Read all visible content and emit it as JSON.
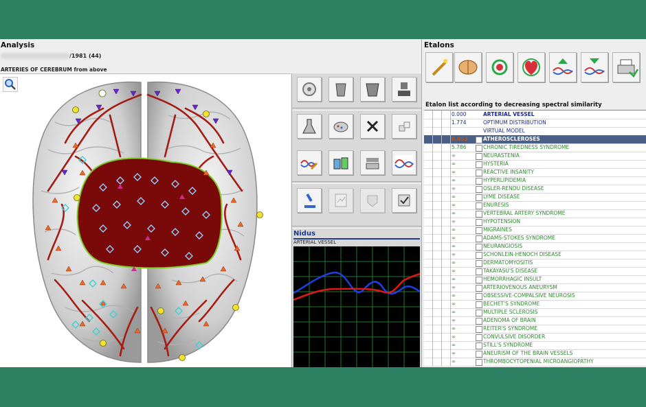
{
  "analysis": {
    "title": "Analysis",
    "patient_suffix": "/1981 (44)",
    "area_label": "ARTERIES  OF  CEREBRUM  from above"
  },
  "viewer": {
    "zoom_icon": "magnifier-icon"
  },
  "tools": {
    "icons": [
      "target-icon",
      "cup-icon",
      "cup-wide-icon",
      "stamp-icon",
      "flask-icon",
      "pipette-icon",
      "close-x-icon",
      "cubes-icon",
      "wave-pencil-icon",
      "beakers-icon",
      "tray-icon",
      "signal-icon",
      "microscope-icon",
      "report-icon",
      "tag-icon",
      "stamp-check-icon"
    ]
  },
  "nidus": {
    "title": "Nidus",
    "subtitle": "ARTERIAL VESSEL",
    "colors": {
      "series_a": "#1f3fe0",
      "series_b": "#e01818",
      "grid": "#1f7a2a"
    }
  },
  "etalons": {
    "title": "Etalons",
    "toolbar_icons": [
      "magic-wand-icon",
      "brain-icon",
      "organ-cycle-icon",
      "heart-icon",
      "spectrum-up-icon",
      "spectrum-down-icon",
      "printer-icon"
    ],
    "list_caption": "Etalon list according to decreasing spectral similarity",
    "rows": [
      {
        "value": "0.000",
        "name": "ARTERIAL VESSEL",
        "style": "header"
      },
      {
        "value": "1.774",
        "name": "OPTIMUM DISTRIBUTION",
        "style": "header"
      },
      {
        "value": "",
        "name": "VIRTUAL MODEL",
        "style": "header"
      },
      {
        "value": "0.053",
        "name": "ATHEROSCLEROSES",
        "style": "selected"
      },
      {
        "value": "5.786",
        "name": "CHRONIC TIREDNESS SYNDROME",
        "style": "item"
      },
      {
        "value": "∞",
        "name": "NEURASTENIA",
        "style": "item"
      },
      {
        "value": "∞",
        "name": "HYSTERIA",
        "style": "item"
      },
      {
        "value": "∞",
        "name": "REACTIVE  INSANITY",
        "style": "item"
      },
      {
        "value": "∞",
        "name": "HYPERLIPIDEMIA",
        "style": "item"
      },
      {
        "value": "∞",
        "name": "OSLER-RENDU DISEASE",
        "style": "item"
      },
      {
        "value": "∞",
        "name": "LYME DISEASE",
        "style": "item"
      },
      {
        "value": "∞",
        "name": "ENURESIS",
        "style": "item"
      },
      {
        "value": "∞",
        "name": "VERTEBRAL  ARTERY  SYNDROME",
        "style": "item"
      },
      {
        "value": "∞",
        "name": "HYPOTENSION",
        "style": "item"
      },
      {
        "value": "∞",
        "name": "MIGRAINES",
        "style": "item"
      },
      {
        "value": "∞",
        "name": "ADAMS-STOKES  SYNDROME",
        "style": "item"
      },
      {
        "value": "∞",
        "name": "NEURANGIOSIS",
        "style": "item"
      },
      {
        "value": "∞",
        "name": "SCHONLEIN-HENOCH  DISEASE",
        "style": "item"
      },
      {
        "value": "∞",
        "name": "DERMATOMYOSITIS",
        "style": "item"
      },
      {
        "value": "∞",
        "name": "TAKAYASU'S DISEASE",
        "style": "item"
      },
      {
        "value": "∞",
        "name": "HEMORRHAGIC  INSULT",
        "style": "item"
      },
      {
        "value": "∞",
        "name": "ARTERIOVENOUS  ANEURYSM",
        "style": "item"
      },
      {
        "value": "∞",
        "name": "OBSESSIVE-COMPALSIVE NEUROSIS",
        "style": "item"
      },
      {
        "value": "∞",
        "name": "BECHET'S  SYNDROME",
        "style": "item"
      },
      {
        "value": "∞",
        "name": "MULTIPLE  SCLEROSIS",
        "style": "item"
      },
      {
        "value": "∞",
        "name": "ADENOMA  OF BRAIN",
        "style": "item"
      },
      {
        "value": "∞",
        "name": "REITER'S  SYNDROME",
        "style": "item"
      },
      {
        "value": "∞",
        "name": "CONVULSIVE DISORDER",
        "style": "item"
      },
      {
        "value": "∞",
        "name": "STILL'S SYNDROME",
        "style": "item"
      },
      {
        "value": "∞",
        "name": "ANEURISM  OF  THE  BRAIN  VESSELS",
        "style": "item"
      },
      {
        "value": "∞",
        "name": "THROMBOCYTOPENIAL  MICROANGIOPATHY",
        "style": "item"
      }
    ],
    "colors": {
      "header": "#1c2a8c",
      "item": "#2d8a2d",
      "selected_value": "#b25a1a",
      "item_value": "#2d8a2d"
    }
  }
}
